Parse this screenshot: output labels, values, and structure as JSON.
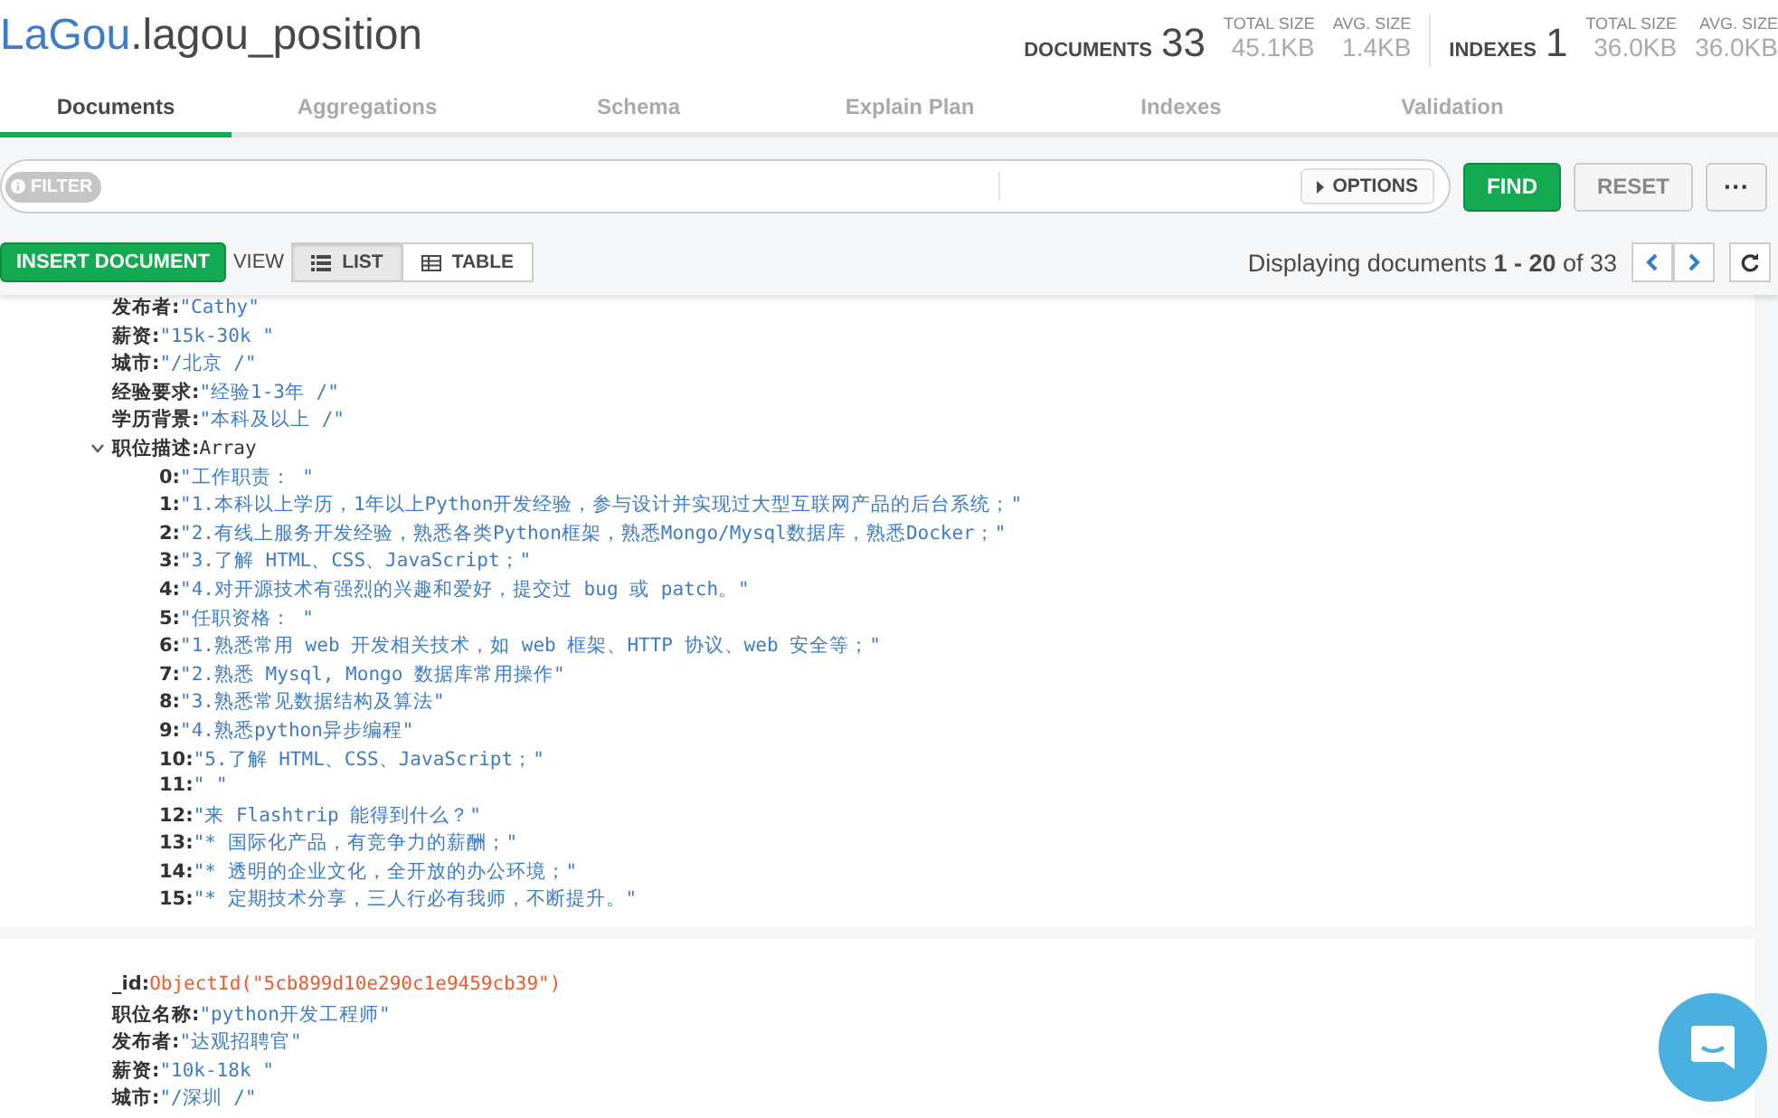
{
  "collection": {
    "database": "LaGou",
    "name": ".lagou_position"
  },
  "stat_groups": [
    {
      "label": "DOCUMENTS",
      "value": "33",
      "details": [
        {
          "label": "TOTAL SIZE",
          "value": "45.1KB"
        },
        {
          "label": "AVG. SIZE",
          "value": "1.4KB"
        }
      ]
    },
    {
      "label": "INDEXES",
      "value": "1",
      "details": [
        {
          "label": "TOTAL SIZE",
          "value": "36.0KB"
        },
        {
          "label": "AVG. SIZE",
          "value": "36.0KB"
        }
      ]
    }
  ],
  "tabs": [
    {
      "label": "Documents",
      "selected": true
    },
    {
      "label": "Aggregations",
      "selected": false
    },
    {
      "label": "Schema",
      "selected": false
    },
    {
      "label": "Explain Plan",
      "selected": false
    },
    {
      "label": "Indexes",
      "selected": false
    },
    {
      "label": "Validation",
      "selected": false
    }
  ],
  "filter": {
    "badge": "FILTER",
    "options_button": "OPTIONS",
    "buttons": [
      {
        "label": "FIND",
        "kind": "primary"
      },
      {
        "label": "RESET",
        "kind": "default"
      },
      {
        "label": "···",
        "kind": "more"
      }
    ]
  },
  "toolbar": {
    "insert_button": "INSERT DOCUMENT",
    "view_label": "VIEW",
    "views": [
      {
        "label": "LIST",
        "selected": true
      },
      {
        "label": "TABLE",
        "selected": false
      }
    ],
    "pagination": "Displaying documents **1 - 20** of 33"
  },
  "documents": [
    {
      "fields": [
        {
          "key": "发布者:",
          "kind": "string",
          "value": "\"Cathy\""
        },
        {
          "key": "薪资:",
          "kind": "string",
          "value": "\"15k-30k \""
        },
        {
          "key": "城市:",
          "kind": "string",
          "value": "\"/北京 /\""
        },
        {
          "key": "经验要求:",
          "kind": "string",
          "value": "\"经验1-3年 /\""
        },
        {
          "key": "学历背景:",
          "kind": "string",
          "value": "\"本科及以上 /\""
        },
        {
          "key": "职位描述:",
          "kind": "array",
          "value": "Array",
          "expanded": true,
          "children": [
            {
              "key": "0:",
              "kind": "string",
              "value": "\"工作职责：  \""
            },
            {
              "key": "1:",
              "kind": "string",
              "value": "\"1.本科以上学历，1年以上Python开发经验，参与设计并实现过大型互联网产品的后台系统；\""
            },
            {
              "key": "2:",
              "kind": "string",
              "value": "\"2.有线上服务开发经验，熟悉各类Python框架，熟悉Mongo/Mysql数据库，熟悉Docker；\""
            },
            {
              "key": "3:",
              "kind": "string",
              "value": "\"3.了解 HTML、CSS、JavaScript；\""
            },
            {
              "key": "4:",
              "kind": "string",
              "value": "\"4.对开源技术有强烈的兴趣和爱好，提交过 bug 或 patch。\""
            },
            {
              "key": "5:",
              "kind": "string",
              "value": "\"任职资格：  \""
            },
            {
              "key": "6:",
              "kind": "string",
              "value": "\"1.熟悉常用 web 开发相关技术，如 web 框架、HTTP 协议、web 安全等；\""
            },
            {
              "key": "7:",
              "kind": "string",
              "value": "\"2.熟悉 Mysql, Mongo 数据库常用操作\""
            },
            {
              "key": "8:",
              "kind": "string",
              "value": "\"3.熟悉常见数据结构及算法\""
            },
            {
              "key": "9:",
              "kind": "string",
              "value": "\"4.熟悉python异步编程\""
            },
            {
              "key": "10:",
              "kind": "string",
              "value": "\"5.了解 HTML、CSS、JavaScript；\""
            },
            {
              "key": "11:",
              "kind": "string",
              "value": "\" \""
            },
            {
              "key": "12:",
              "kind": "string",
              "value": "\"来 Flashtrip 能得到什么？\""
            },
            {
              "key": "13:",
              "kind": "string",
              "value": "\"* 国际化产品，有竞争力的薪酬；\""
            },
            {
              "key": "14:",
              "kind": "string",
              "value": "\"* 透明的企业文化，全开放的办公环境；\""
            },
            {
              "key": "15:",
              "kind": "string",
              "value": "\"* 定期技术分享，三人行必有我师，不断提升。\""
            }
          ]
        }
      ]
    },
    {
      "fields": [
        {
          "key": "_id:",
          "kind": "objectid",
          "value": "ObjectId(\"5cb899d10e290c1e9459cb39\")"
        },
        {
          "key": "职位名称:",
          "kind": "string",
          "value": "\"python开发工程师\""
        },
        {
          "key": "发布者:",
          "kind": "string",
          "value": "\"达观招聘官\""
        },
        {
          "key": "薪资:",
          "kind": "string",
          "value": "\"10k-18k \""
        },
        {
          "key": "城市:",
          "kind": "string",
          "value": "\"/深圳 /\""
        }
      ]
    }
  ]
}
